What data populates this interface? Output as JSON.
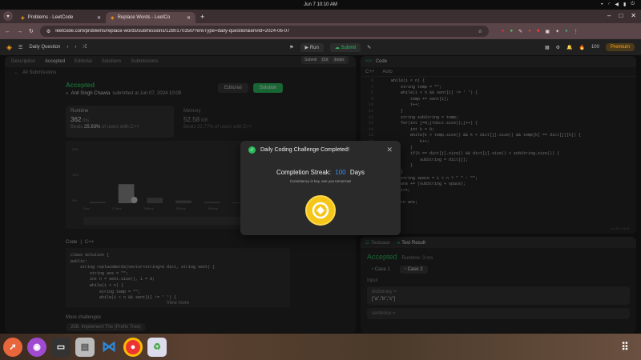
{
  "system": {
    "clock": "Jun 7  10:10 AM"
  },
  "browser": {
    "tabs": [
      {
        "title": "Problems - LeetCode"
      },
      {
        "title": "Replace Words - LeetCo"
      }
    ],
    "url": "leetcode.com/problems/replace-words/submissions/1280170350/?envType=daily-question&envId=2024-06-07"
  },
  "nav": {
    "title": "Daily Question",
    "run": "Run",
    "submit": "Submit",
    "coins": "100",
    "premium": "Premium"
  },
  "left": {
    "tabs": [
      "Description",
      "Accepted",
      "Editorial",
      "Solutions",
      "Submissions"
    ],
    "all_submissions": "All Submissions",
    "status": "Accepted",
    "author": "Anil Singh Chawla",
    "submitted": "submitted at Jun 07, 2024 10:09",
    "editorial_btn": "Editorial",
    "solution_btn": "Solution",
    "runtime_label": "Runtime",
    "runtime_value": "362",
    "runtime_unit": "ms",
    "beats": "Beats",
    "beats_pct": "25.93%",
    "beats_suffix": "of users with C++",
    "memory_label": "Memory",
    "memory_value": "52.58",
    "memory_unit": "MB",
    "memory_beats": "Beats 32.77% of users with C++",
    "ticks": [
      "2ms",
      "174ms",
      "346ms",
      "518ms",
      "690ms",
      "862ms",
      "1034ms"
    ],
    "chart_y": [
      "20%",
      "10%",
      "0%"
    ],
    "code_label": "Code",
    "code_lang": "C++",
    "code_lines": [
      "class Solution {",
      "public:",
      "    string replaceWords(vector<string>& dict, string sent) {",
      "        string ans = \"\";",
      "        int n = sent.size(), i = 0;",
      "        while(i < n) {",
      "            string temp = \"\";",
      "            while(i < n && sent[i] != ' ') {"
    ],
    "view_more": "View more",
    "more_challenges": "More challenges",
    "challenge": "208. Implement Trie (Prefix Tree)"
  },
  "tooltip": {
    "label": "Submit",
    "k1": "Ctrl",
    "k2": "Enter"
  },
  "right": {
    "code_tab": "Code",
    "lang": "C++",
    "auto": "Auto",
    "line_numbers": [
      "6",
      "7",
      "8",
      "9",
      "10",
      "11",
      "12",
      "13",
      "14",
      "15",
      "16",
      "17",
      "18",
      "19",
      "20",
      "21",
      "22",
      "23",
      "24",
      "25",
      "26"
    ],
    "lines": [
      "while(i < n) {",
      "    string temp = \"\";",
      "    while(i < n && sent[i] != ' ') {",
      "        temp += sent[i];",
      "        i++;",
      "    }",
      "",
      "    string subString = temp;",
      "    for(int j=0;j<dict.size();j++) {",
      "        int k = 0;",
      "        while(k < temp.size() && k < dict[j].size() && temp[k] == dict[j][k]) {",
      "            k++;",
      "        }",
      "        if(k == dict[j].size() && dict[j].size() < subString.size()) {",
      "            subString = dict[j];",
      "        }",
      "    }",
      "    string space = i < n ? \" \" : \"\";",
      "    ans += (subString + space);",
      "    i++;",
      "}",
      "return ans;"
    ],
    "cursor": "Ln 30, Col 81",
    "testcase_tab": "Testcase",
    "result_tab": "Test Result",
    "result": "Accepted",
    "runtime": "Runtime: 3 ms",
    "case1": "Case 1",
    "case2": "Case 2",
    "input_label": "Input",
    "dict_label": "dictionary =",
    "dict_value": "[\"a\",\"b\",\"c\"]",
    "sent_label": "sentence ="
  },
  "modal": {
    "title": "Daily Coding Challenge Completed!",
    "streak_prefix": "Completion Streak:",
    "streak": "100",
    "streak_suffix": "Days",
    "note": "Consistency is key, see you tomorrow!"
  },
  "chart_data": {
    "type": "bar",
    "categories": [
      "2ms",
      "174ms",
      "346ms",
      "518ms",
      "690ms",
      "862ms",
      "1034ms"
    ],
    "values": [
      0.5,
      7,
      2,
      1,
      0.5,
      0.3,
      0.2
    ],
    "ylim": [
      0,
      20
    ]
  }
}
